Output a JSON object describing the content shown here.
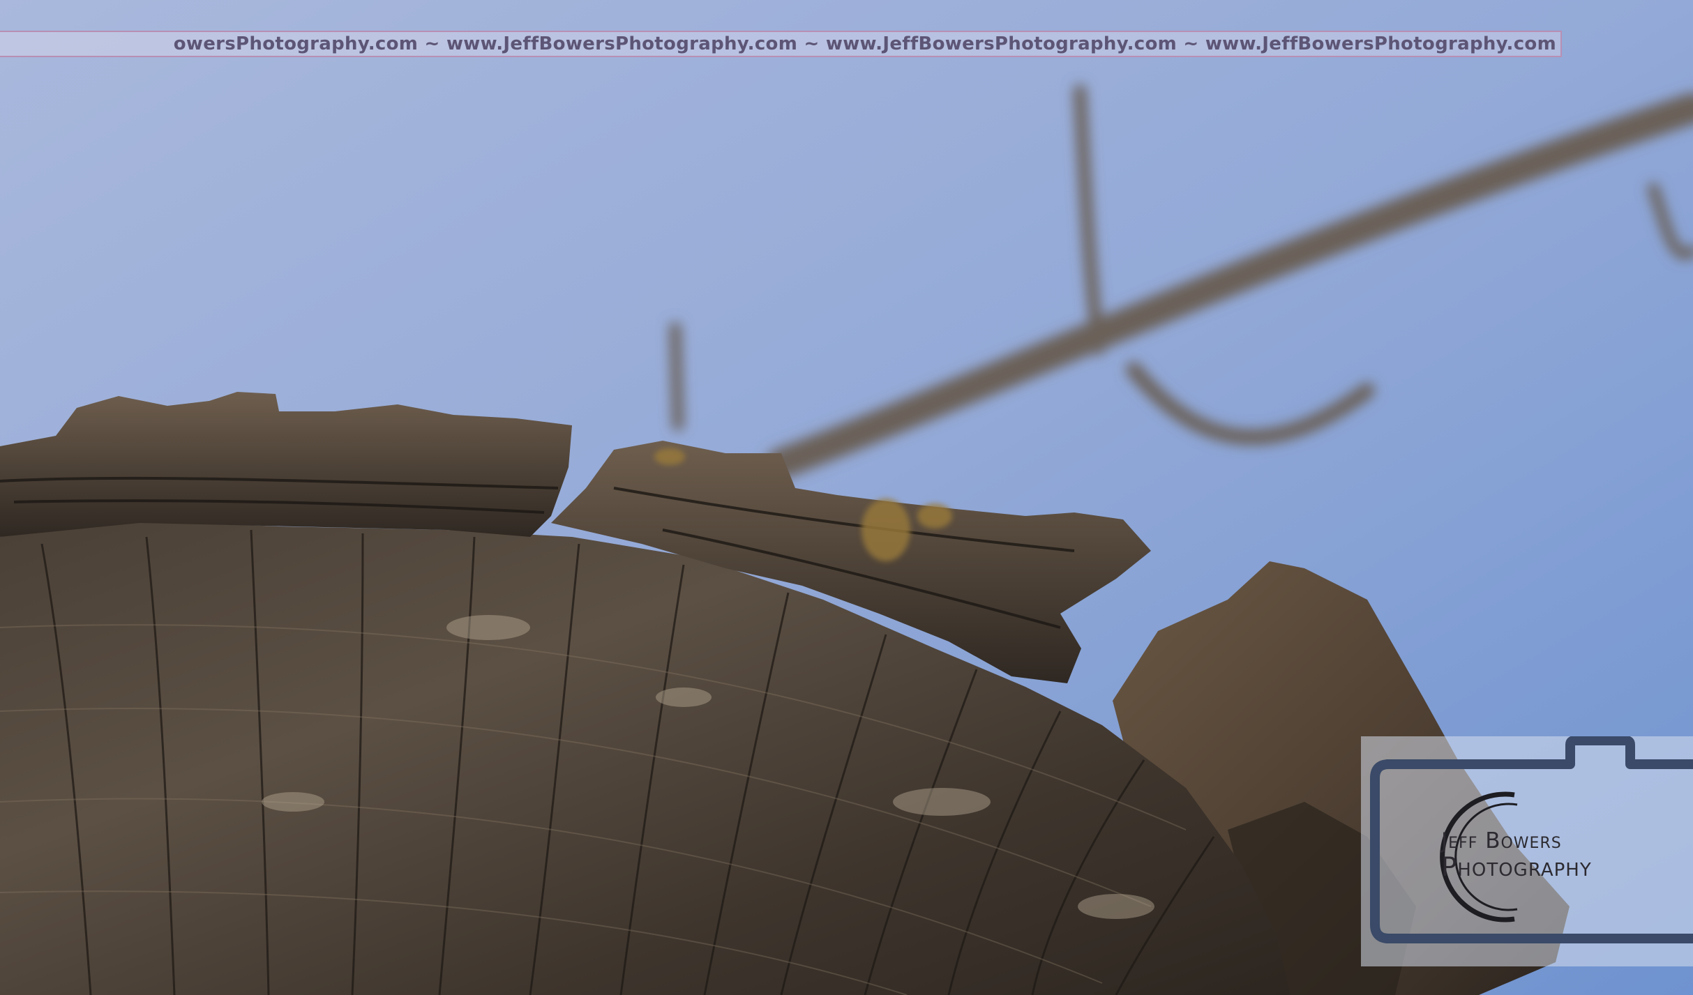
{
  "watermark": {
    "banner_text": "owersPhotography.com ~ www.JeffBowersPhotography.com ~ www.JeffBowersPhotography.com ~ www.JeffBowersPhotography.com"
  },
  "logo": {
    "name": "Jeff Bowers",
    "subtitle": "Photography"
  },
  "colors": {
    "sky_top": "#a6b6dc",
    "sky_bottom": "#7f9fd6",
    "wood_dark": "#3a3028",
    "wood_light": "#7a6a58",
    "banner_border": "#b88fb4",
    "logo_ink": "#2c2a30"
  }
}
